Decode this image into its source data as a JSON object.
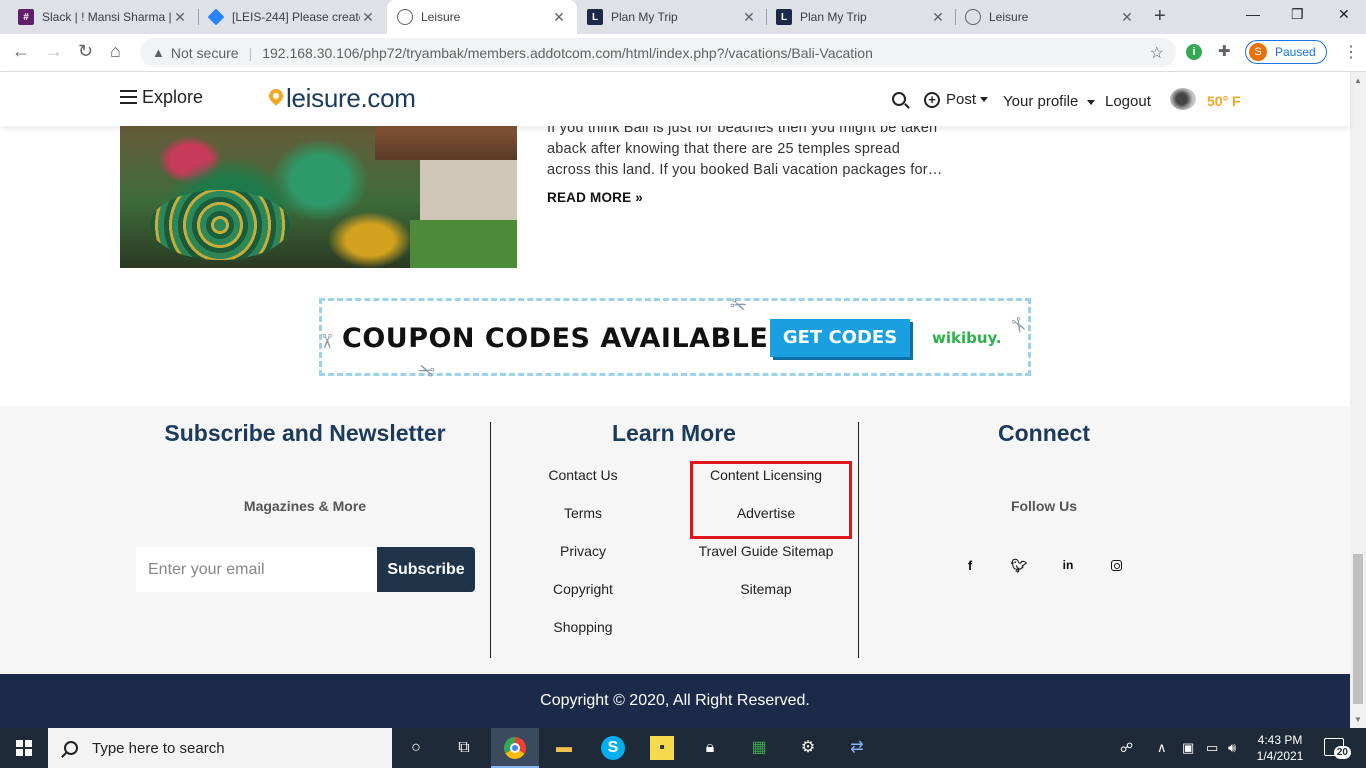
{
  "browser": {
    "tabs": [
      {
        "title": "Slack | ! Mansi Sharma |",
        "icon": "slack-icon",
        "color": "#611f69"
      },
      {
        "title": "[LEIS-244] Please create",
        "icon": "jira-icon",
        "color": "#2684ff"
      },
      {
        "title": "Leisure",
        "icon": "globe-icon",
        "color": "#5f6368",
        "active": true
      },
      {
        "title": "Plan My Trip",
        "icon": "letter-l-icon",
        "color": "#1c2a4a"
      },
      {
        "title": "Plan My Trip",
        "icon": "letter-l-icon",
        "color": "#1c2a4a"
      },
      {
        "title": "Leisure",
        "icon": "globe-icon",
        "color": "#5f6368"
      }
    ],
    "security_label": "Not secure",
    "url": "192.168.30.106/php72/tryambak/members.addotcom.com/html/index.php?/vacations/Bali-Vacation",
    "profile_initial": "S",
    "profile_status": "Paused"
  },
  "site": {
    "explore": "Explore",
    "logo": "leisure.com",
    "post": "Post",
    "profile": "Your profile",
    "logout": "Logout",
    "temperature": "50° F",
    "accent": "#f5a623",
    "brand": "#1c3a5b"
  },
  "article": {
    "text": "If you think Bali is just for beaches then you might be taken aback after knowing that there are 25 temples spread across this land. If you booked Bali vacation packages for…",
    "read_more": "READ MORE »"
  },
  "ad": {
    "headline": "COUPON CODES AVAILABLE",
    "cta": "GET CODES",
    "brand": "wikibuy."
  },
  "footer": {
    "subscribe": {
      "title": "Subscribe and Newsletter",
      "subtitle": "Magazines & More",
      "email_placeholder": "Enter your email",
      "button": "Subscribe"
    },
    "learn_more": {
      "title": "Learn More",
      "left_links": [
        "Contact Us",
        "Terms",
        "Privacy",
        "Copyright",
        "Shopping"
      ],
      "right_links": [
        "Content Licensing",
        "Advertise",
        "Travel Guide Sitemap",
        "Sitemap"
      ]
    },
    "connect": {
      "title": "Connect",
      "subtitle": "Follow Us",
      "socials": [
        "facebook-icon",
        "twitter-icon",
        "linkedin-icon",
        "instagram-icon"
      ]
    },
    "copyright": "Copyright © 2020, All Right Reserved."
  },
  "taskbar": {
    "search_placeholder": "Type here to search",
    "time": "4:43 PM",
    "date": "1/4/2021",
    "notifications": "20"
  }
}
